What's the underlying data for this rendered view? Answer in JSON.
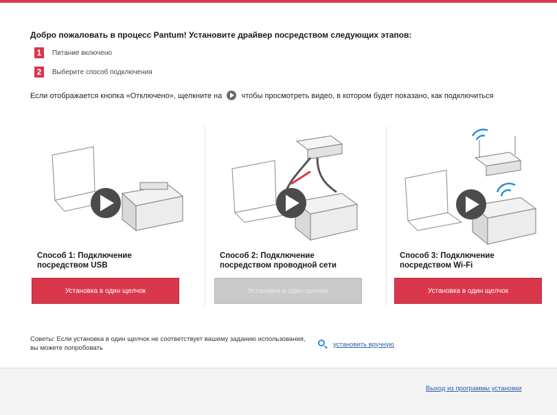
{
  "header": {
    "headline": "Добро пожаловать в процесс Pantum! Установите драйвер посредством следующих этапов:"
  },
  "steps": [
    {
      "num": "1",
      "text": "Питание включено"
    },
    {
      "num": "2",
      "text": "Выберите способ подключения"
    }
  ],
  "info": {
    "before": "Если отображается кнопка «Отключено», щелкните на",
    "after": "чтобы просмотреть видео, в котором будет показано, как подключиться"
  },
  "options": [
    {
      "title": "Способ 1: Подключение посредством USB",
      "button": "Установка в один щелчок",
      "enabled": true
    },
    {
      "title": "Способ 2: Подключение посредством проводной сети",
      "button": "Установка в один щелчок",
      "enabled": false
    },
    {
      "title": "Способ 3: Подключение посредством Wi-Fi",
      "button": "Установка в один щелчок",
      "enabled": true
    }
  ],
  "tip": {
    "text": "Советы: Если установка в один щелчок не соответствует вашему заданию использования, вы можете попробовать"
  },
  "help": {
    "link": "установить вручную"
  },
  "footer": {
    "link": "Выход из программы установки"
  },
  "colors": {
    "accent": "#d9374b",
    "disabled": "#c9c9c9",
    "link": "#2a5db0",
    "wifi": "#2b8ed6"
  }
}
